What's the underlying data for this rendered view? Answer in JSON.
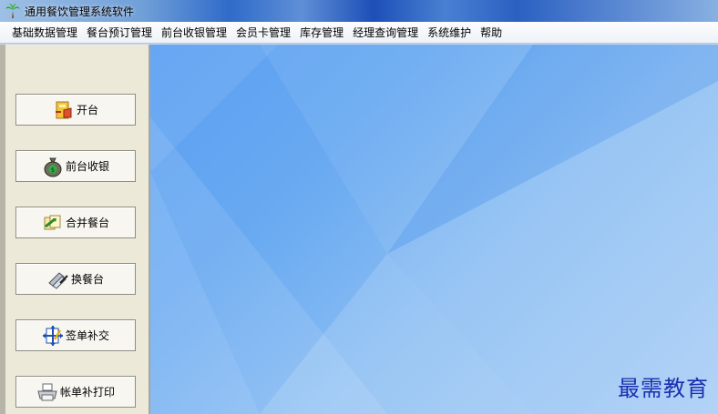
{
  "window": {
    "title": "通用餐饮管理系统软件",
    "app_icon": "palm-tree-icon"
  },
  "menu": [
    {
      "label": "基础数据管理"
    },
    {
      "label": "餐台预订管理"
    },
    {
      "label": "前台收银管理"
    },
    {
      "label": "会员卡管理"
    },
    {
      "label": "库存管理"
    },
    {
      "label": "经理查询管理"
    },
    {
      "label": "系统维护"
    },
    {
      "label": "帮助"
    }
  ],
  "sidebar": {
    "buttons": [
      {
        "label": "开台",
        "icon": "open-table-icon"
      },
      {
        "label": "前台收银",
        "icon": "money-bag-icon"
      },
      {
        "label": "合并餐台",
        "icon": "merge-tables-icon"
      },
      {
        "label": "换餐台",
        "icon": "swap-table-icon"
      },
      {
        "label": "签单补交",
        "icon": "sign-bill-icon"
      },
      {
        "label": "帐单补打印",
        "icon": "printer-icon"
      }
    ]
  },
  "main": {
    "watermark": "最需教育"
  },
  "colors": {
    "sidebar_bg": "#ece9d8",
    "desktop_blue": "#5b9ff2",
    "watermark": "#1a2fb0"
  }
}
